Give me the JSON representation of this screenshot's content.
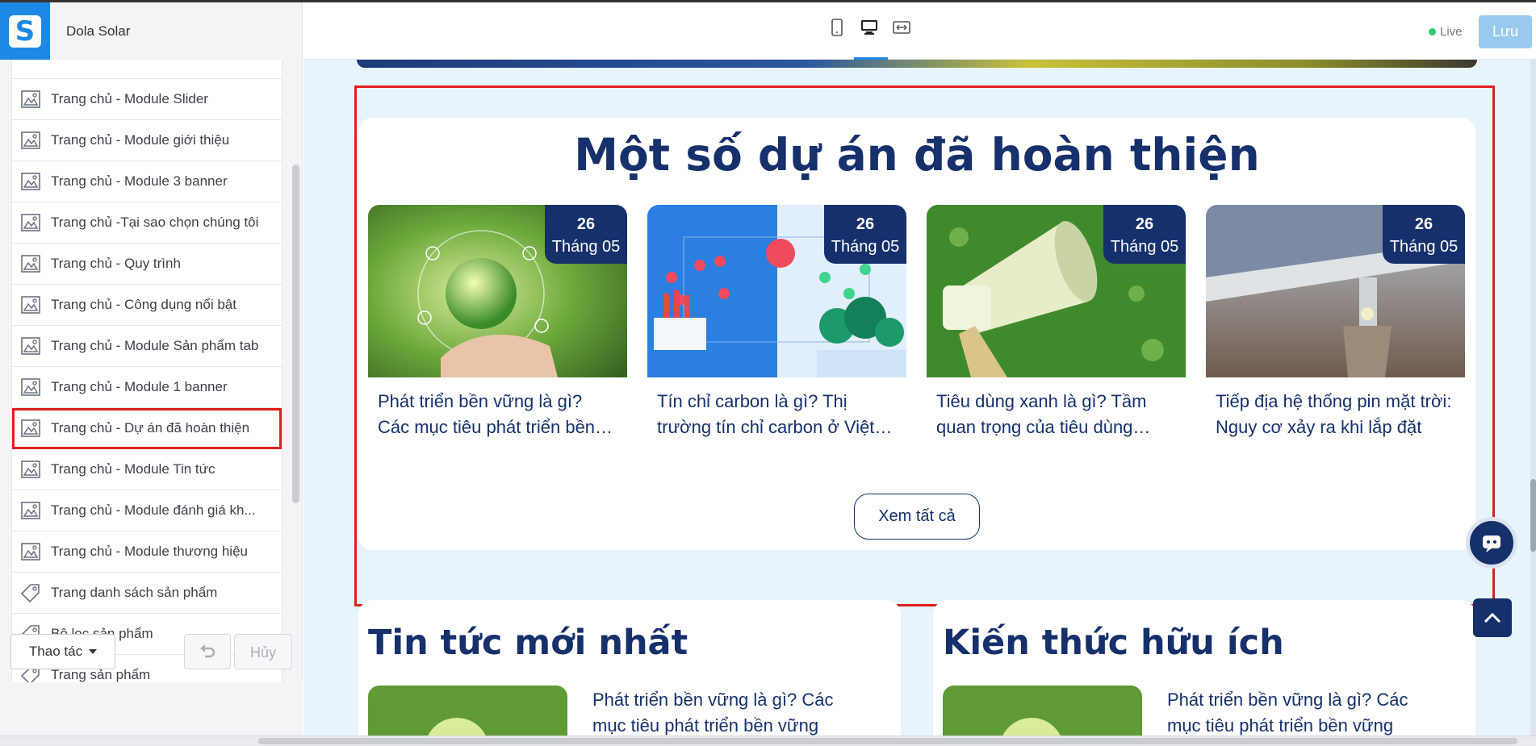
{
  "header": {
    "store_name": "Dola Solar",
    "live_label": "Live",
    "save_label": "Lưu",
    "devices": [
      "mobile-icon",
      "desktop-icon",
      "fullwidth-icon"
    ]
  },
  "sidebar": {
    "items": [
      {
        "label": "Trang chủ - Module Slider",
        "icon": "layout-icon"
      },
      {
        "label": "Trang chủ - Module giới thiệu",
        "icon": "layout-icon"
      },
      {
        "label": "Trang chủ - Module 3 banner",
        "icon": "layout-icon"
      },
      {
        "label": "Trang chủ -Tại sao chọn chúng tôi",
        "icon": "layout-icon"
      },
      {
        "label": "Trang chủ - Quy trình",
        "icon": "layout-icon"
      },
      {
        "label": "Trang chủ - Công dụng nổi bật",
        "icon": "layout-icon"
      },
      {
        "label": "Trang chủ - Module Sản phẩm tab",
        "icon": "layout-icon"
      },
      {
        "label": "Trang chủ - Module 1 banner",
        "icon": "layout-icon"
      },
      {
        "label": "Trang chủ - Dự án đã hoàn thiện",
        "icon": "layout-icon",
        "selected": true
      },
      {
        "label": "Trang chủ - Module Tin tức",
        "icon": "layout-icon"
      },
      {
        "label": "Trang chủ - Module đánh giá kh...",
        "icon": "layout-icon"
      },
      {
        "label": "Trang chủ - Module thương hiệu",
        "icon": "layout-icon"
      },
      {
        "label": "Trang danh sách sản phẩm",
        "icon": "tag-icon"
      },
      {
        "label": "Bộ lọc sản phẩm",
        "icon": "tag-icon"
      },
      {
        "label": "Trang sản phẩm",
        "icon": "tag-icon"
      }
    ],
    "action_label": "Thao tác",
    "cancel_label": "Hủy"
  },
  "preview": {
    "projects": {
      "title": "Một số dự án đã hoàn thiện",
      "items": [
        {
          "day": "26",
          "month": "Tháng 05",
          "title": "Phát triển bền vững là gì? Các mục tiêu phát triển bền vững"
        },
        {
          "day": "26",
          "month": "Tháng 05",
          "title": "Tín chỉ carbon là gì? Thị trường tín chỉ carbon ở Việt Nam"
        },
        {
          "day": "26",
          "month": "Tháng 05",
          "title": "Tiêu dùng xanh là gì? Tầm quan trọng của tiêu dùng xanh"
        },
        {
          "day": "26",
          "month": "Tháng 05",
          "title": "Tiếp địa hệ thống pin mặt trời: Nguy cơ xảy ra khi lắp đặt"
        }
      ],
      "see_all_label": "Xem tất cả"
    },
    "news": {
      "title": "Tin tức mới nhất",
      "first_title": "Phát triển bền vững là gì? Các mục tiêu phát triển bền vững"
    },
    "knowledge": {
      "title": "Kiến thức hữu ích",
      "first_title": "Phát triển bền vững là gì? Các mục tiêu phát triển bền vững"
    }
  },
  "colors": {
    "brand_navy": "#16306b",
    "accent_blue": "#1e88e5",
    "highlight_red": "#e01e1e",
    "live_green": "#2ecc71"
  }
}
